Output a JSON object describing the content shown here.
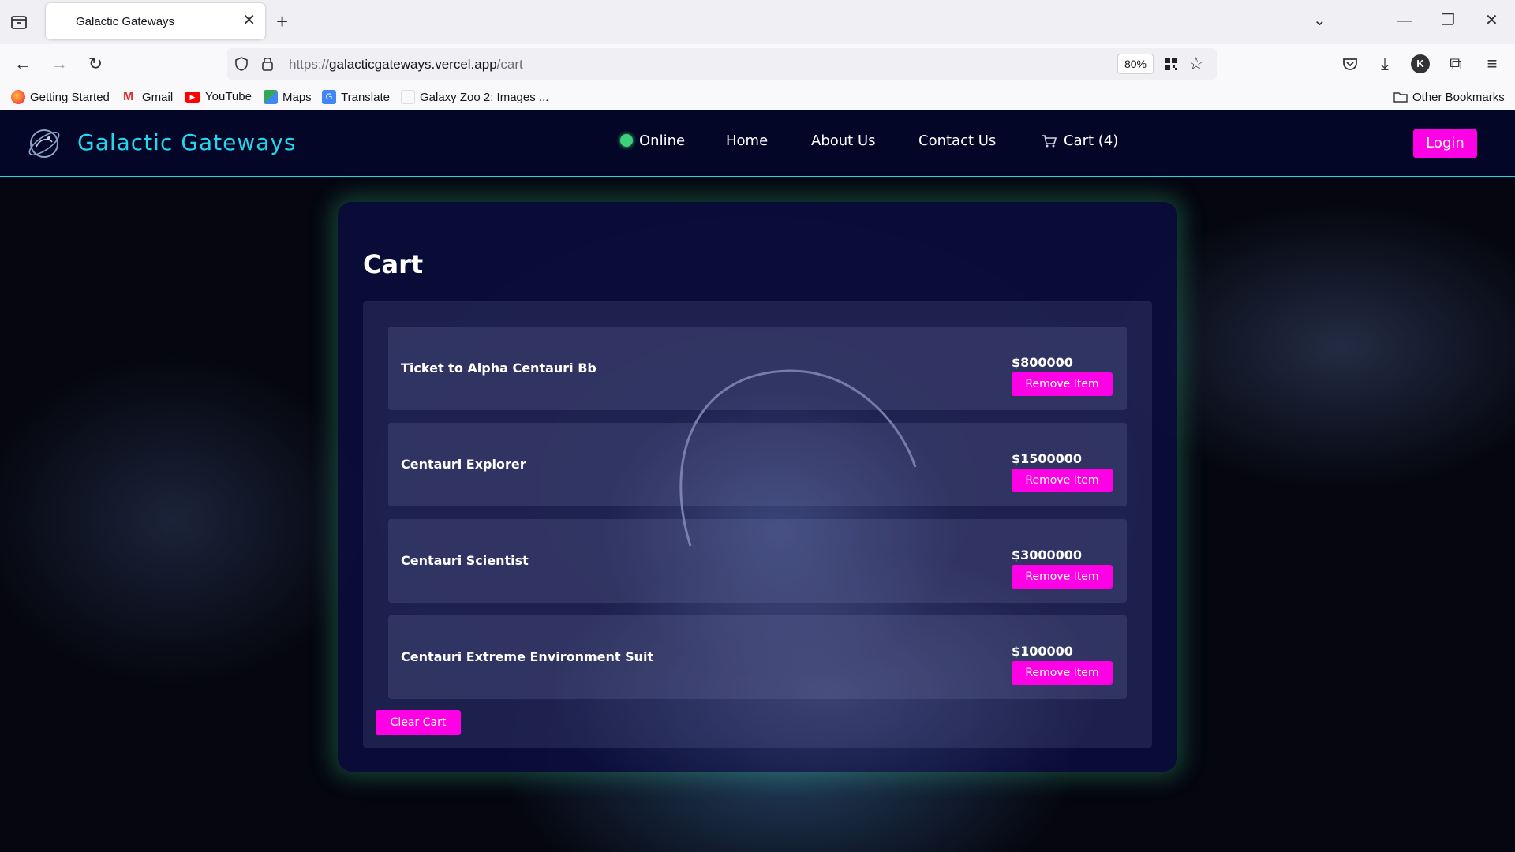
{
  "browser": {
    "tab_title": "Galactic Gateways",
    "url_prefix": "https://",
    "url_host": "galacticgateways.vercel.app",
    "url_path": "/cart",
    "zoom": "80%",
    "bookmarks": [
      "Getting Started",
      "Gmail",
      "YouTube",
      "Maps",
      "Translate",
      "Galaxy Zoo 2: Images ..."
    ],
    "other_bookmarks": "Other Bookmarks",
    "profile_initial": "K"
  },
  "site": {
    "brand": "Galactic Gateways",
    "nav": {
      "online": "Online",
      "home": "Home",
      "about": "About Us",
      "contact": "Contact Us",
      "cart": "Cart (4)"
    },
    "login": "Login"
  },
  "cart": {
    "title": "Cart",
    "items": [
      {
        "name": "Ticket to Alpha Centauri Bb",
        "price": "$800000",
        "remove_label": "Remove Item"
      },
      {
        "name": "Centauri Explorer",
        "price": "$1500000",
        "remove_label": "Remove Item"
      },
      {
        "name": "Centauri Scientist",
        "price": "$3000000",
        "remove_label": "Remove Item"
      },
      {
        "name": "Centauri Extreme Environment Suit",
        "price": "$100000",
        "remove_label": "Remove Item"
      }
    ],
    "clear_label": "Clear Cart"
  },
  "colors": {
    "accent_pink": "#ff00e6",
    "brand_cyan": "#21d8ee",
    "header_bg": "#030626",
    "online_green": "#3fd17a"
  }
}
